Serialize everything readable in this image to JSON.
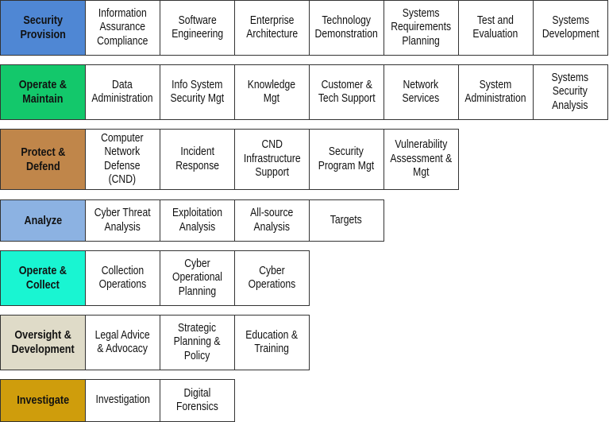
{
  "rows": [
    {
      "category": "Security\nProvision",
      "color": "#4f87d4",
      "items": [
        "Information\nAssurance\nCompliance",
        "Software\nEngineering",
        "Enterprise\nArchitecture",
        "Technology\nDemonstration",
        "Systems\nRequirements\nPlanning",
        "Test and\nEvaluation",
        "Systems\nDevelopment"
      ]
    },
    {
      "category": "Operate &\nMaintain",
      "color": "#13c86b",
      "items": [
        "Data\nAdministration",
        "Info System\nSecurity Mgt",
        "Knowledge\nMgt",
        "Customer &\nTech Support",
        "Network\nServices",
        "System\nAdministration",
        "Systems\nSecurity\nAnalysis"
      ]
    },
    {
      "category": "Protect &\nDefend",
      "color": "#c0864a",
      "items": [
        "Computer\nNetwork\nDefense\n(CND)",
        "Incident\nResponse",
        "CND\nInfrastructure\nSupport",
        "Security\nProgram Mgt",
        "Vulnerability\nAssessment &\nMgt"
      ]
    },
    {
      "category": "Analyze",
      "color": "#8cb2e2",
      "items": [
        "Cyber Threat\nAnalysis",
        "Exploitation\nAnalysis",
        "All-source\nAnalysis",
        "Targets"
      ]
    },
    {
      "category": "Operate &\nCollect",
      "color": "#19f5d2",
      "items": [
        "Collection\nOperations",
        "Cyber\nOperational\nPlanning",
        "Cyber\nOperations"
      ]
    },
    {
      "category": "Oversight &\nDevelopment",
      "color": "#dfdbc8",
      "items": [
        "Legal Advice\n& Advocacy",
        "Strategic\nPlanning &\nPolicy",
        "Education &\nTraining"
      ]
    },
    {
      "category": "Investigate",
      "color": "#cf9d0c",
      "items": [
        "Investigation",
        "Digital\nForensics"
      ]
    }
  ]
}
